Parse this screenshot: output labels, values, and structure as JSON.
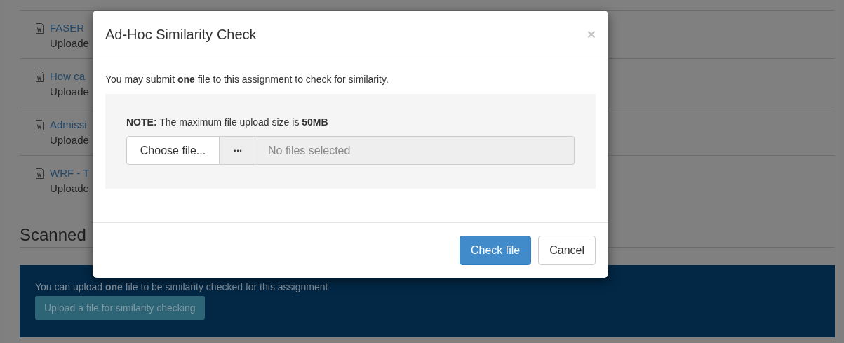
{
  "background": {
    "files": [
      {
        "title": "FASER",
        "status": "Uploade"
      },
      {
        "title": "How ca",
        "status": "Uploade"
      },
      {
        "title": "Admissi",
        "status": "Uploade"
      },
      {
        "title": "WRF - T",
        "status": "Uploade"
      }
    ],
    "section_heading": "Scanned",
    "banner": {
      "text": "You can upload **one** file to be similarity checked for this assignment",
      "button": "Upload a file for similarity checking"
    }
  },
  "dialog": {
    "title": "Ad-Hoc Similarity Check",
    "close": "×",
    "intro": "You may submit **one** file to this assignment to check for similarity.",
    "note": "**NOTE:** The maximum file upload size is **50MB**",
    "file_picker": {
      "choose_button": "Choose file...",
      "more_button": "•••",
      "placeholder": "No files selected"
    },
    "buttons": [
      {
        "label": "Check file",
        "kind": "primary"
      },
      {
        "label": "Cancel",
        "kind": "default"
      }
    ]
  }
}
